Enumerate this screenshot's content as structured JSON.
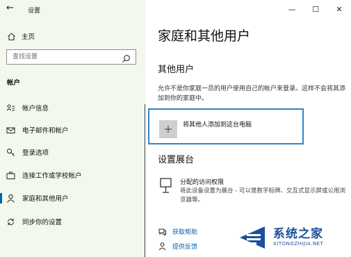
{
  "app": {
    "title": "设置"
  },
  "window_controls": {
    "minimize": "—",
    "maximize": "☐",
    "close": "✕"
  },
  "sidebar": {
    "back_symbol": "←",
    "home_label": "主页",
    "search_placeholder": "查找设置",
    "section_label": "帐户",
    "items": [
      {
        "label": "帐户信息",
        "icon": "account-info-icon"
      },
      {
        "label": "电子邮件和帐户",
        "icon": "mail-icon"
      },
      {
        "label": "登录选项",
        "icon": "key-icon"
      },
      {
        "label": "连接工作或学校帐户",
        "icon": "briefcase-icon"
      },
      {
        "label": "家庭和其他用户",
        "icon": "person-icon",
        "active": true
      },
      {
        "label": "同步你的设置",
        "icon": "sync-icon"
      }
    ]
  },
  "main": {
    "page_title": "家庭和其他用户",
    "other_users": {
      "heading": "其他用户",
      "description": "允许不是你家庭一员的用户使用自己的帐户来登录。这样不会将其添加到你的家庭中。",
      "add_label": "将其他人添加到这台电脑",
      "add_symbol": "+"
    },
    "kiosk": {
      "heading": "设置展台",
      "title": "分配的访问权限",
      "description": "将此设备设置为展台 - 可以是数字标牌、交互式显示屏或公用浏览器等。"
    },
    "links": {
      "help": "获取帮助",
      "feedback": "提供反馈"
    }
  },
  "watermark": {
    "name": "系统之家",
    "url": "XITONGZHIJIA.NET"
  },
  "colors": {
    "accent": "#0063b1",
    "sidebar_bg": "#f2f8ec",
    "focus_border": "#2e84c8"
  }
}
